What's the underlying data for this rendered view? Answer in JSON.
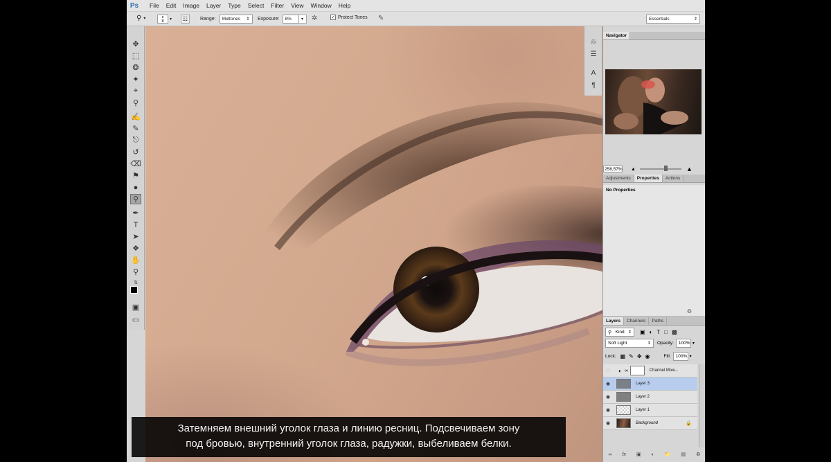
{
  "app": {
    "logo": "Ps"
  },
  "menu": [
    "File",
    "Edit",
    "Image",
    "Layer",
    "Type",
    "Select",
    "Filter",
    "View",
    "Window",
    "Help"
  ],
  "options": {
    "brush_size": "8",
    "range_label": "Range:",
    "range_value": "Midtones",
    "exposure_label": "Exposure:",
    "exposure_value": "8%",
    "protect_tones_label": "Protect Tones",
    "protect_tones_checked": true,
    "workspace": "Essentials"
  },
  "tools": [
    "move-icon",
    "marquee-icon",
    "lasso-icon",
    "quick-select-icon",
    "crop-icon",
    "eyedropper-icon",
    "healing-icon",
    "brush-icon",
    "clone-stamp-icon",
    "history-brush-icon",
    "eraser-icon",
    "paint-bucket-icon",
    "blur-icon",
    "dodge-icon",
    "pen-icon",
    "type-icon",
    "path-select-icon",
    "shape-icon",
    "hand-icon",
    "zoom-icon"
  ],
  "active_tool": "dodge-icon",
  "navigator": {
    "tab": "Navigator",
    "zoom": "258,57%"
  },
  "properties_panel": {
    "tabs": [
      "Adjustments",
      "Properties",
      "Actions"
    ],
    "active_tab": "Properties",
    "body": "No Properties"
  },
  "layers_panel": {
    "tabs": [
      "Layers",
      "Channels",
      "Paths"
    ],
    "active_tab": "Layers",
    "kind": "Kind",
    "blend_mode": "Soft Light",
    "opacity_label": "Opacity:",
    "opacity": "100%",
    "lock_label": "Lock:",
    "fill_label": "Fill:",
    "fill": "100%",
    "layers": [
      {
        "name": "Channel Mixe...",
        "visible": false,
        "thumb": "adjustment",
        "selected": false
      },
      {
        "name": "Layer 3",
        "visible": true,
        "thumb": "gray",
        "selected": true
      },
      {
        "name": "Layer 2",
        "visible": true,
        "thumb": "gray",
        "selected": false
      },
      {
        "name": "Layer 1",
        "visible": true,
        "thumb": "transparent",
        "selected": false
      },
      {
        "name": "Background",
        "visible": true,
        "thumb": "photo",
        "selected": false,
        "locked": true
      }
    ]
  },
  "subtitle": {
    "line1": "Затемняем внешний уголок глаза и линию ресниц. Подсвечиваем зону",
    "line2": "под бровью, внутренний уголок глаза, радужки, выбеливаем белки."
  },
  "colors": {
    "selection": "#b8cdee",
    "panel": "#d6d6d6",
    "logo": "#2d6fb0"
  }
}
